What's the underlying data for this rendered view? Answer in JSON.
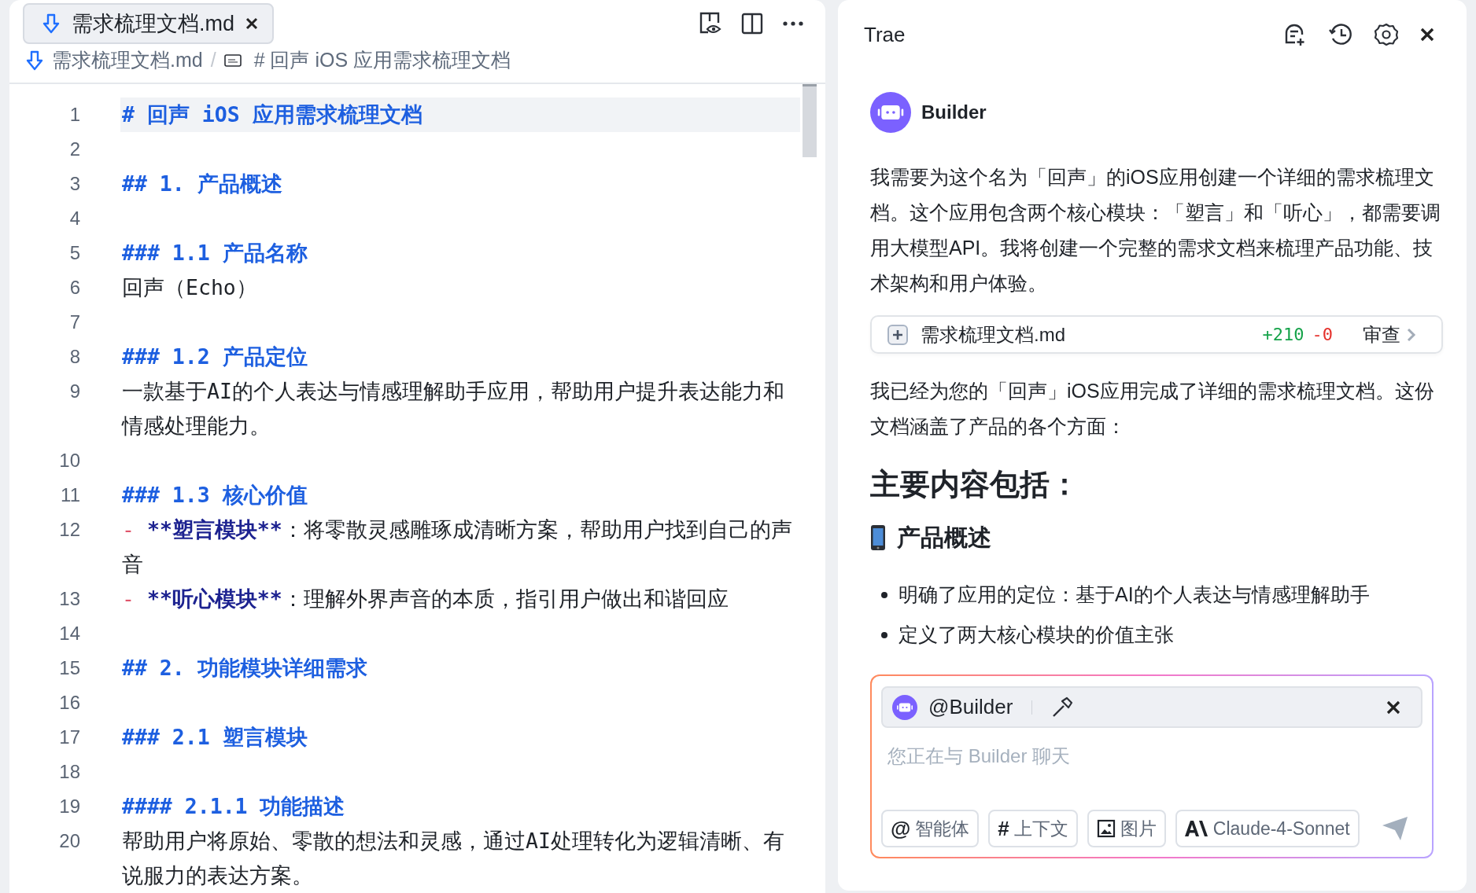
{
  "editor": {
    "tab": {
      "label": "需求梳理文档.md",
      "selected": true
    },
    "breadcrumb": {
      "file": "需求梳理文档.md",
      "separator": "/",
      "symbol": "# 回声 iOS 应用需求梳理文档"
    },
    "lines": [
      {
        "number": "1",
        "kind": "heading",
        "current": true,
        "text": "# 回声 iOS 应用需求梳理文档"
      },
      {
        "number": "2",
        "kind": "blank",
        "current": false
      },
      {
        "number": "3",
        "kind": "heading",
        "current": false,
        "text": "## 1. 产品概述"
      },
      {
        "number": "4",
        "kind": "blank",
        "current": false
      },
      {
        "number": "5",
        "kind": "heading",
        "current": false,
        "text": "### 1.1 产品名称"
      },
      {
        "number": "6",
        "kind": "text",
        "current": false,
        "text": "回声（Echo）"
      },
      {
        "number": "7",
        "kind": "blank",
        "current": false
      },
      {
        "number": "8",
        "kind": "heading",
        "current": false,
        "text": "### 1.2 产品定位"
      },
      {
        "number": "9",
        "kind": "text",
        "current": false,
        "text": "一款基于AI的个人表达与情感理解助手应用，帮助用户提升表达能力和情感处理能力。"
      },
      {
        "number": "10",
        "kind": "blank",
        "current": false
      },
      {
        "number": "11",
        "kind": "heading",
        "current": false,
        "text": "### 1.3 核心价值"
      },
      {
        "number": "12",
        "kind": "bullet",
        "current": false,
        "marker": "-",
        "emphasis": "**塑言模块**",
        "text": "：将零散灵感雕琢成清晰方案，帮助用户找到自己的声音"
      },
      {
        "number": "13",
        "kind": "bullet",
        "current": false,
        "marker": "-",
        "emphasis": "**听心模块**",
        "text": "：理解外界声音的本质，指引用户做出和谐回应"
      },
      {
        "number": "14",
        "kind": "blank",
        "current": false
      },
      {
        "number": "15",
        "kind": "heading",
        "current": false,
        "text": "## 2. 功能模块详细需求"
      },
      {
        "number": "16",
        "kind": "blank",
        "current": false
      },
      {
        "number": "17",
        "kind": "heading",
        "current": false,
        "text": "### 2.1 塑言模块"
      },
      {
        "number": "18",
        "kind": "blank",
        "current": false
      },
      {
        "number": "19",
        "kind": "heading",
        "current": false,
        "text": "#### 2.1.1 功能描述"
      },
      {
        "number": "20",
        "kind": "text",
        "current": false,
        "text": "帮助用户将原始、零散的想法和灵感，通过AI处理转化为逻辑清晰、有说服力的表达方案。"
      }
    ]
  },
  "chat": {
    "title": "Trae",
    "agent": "Builder",
    "messages": [
      {
        "kind": "paragraph",
        "text": "我需要为这个名为「回声」的iOS应用创建一个详细的需求梳理文档。这个应用包含两个核心模块：「塑言」和「听心」，都需要调用大模型API。我将创建一个完整的需求文档来梳理产品功能、技术架构和用户体验。"
      },
      {
        "kind": "file_change",
        "file": "需求梳理文档.md",
        "added": "+210",
        "removed": "-0",
        "action": "审查"
      },
      {
        "kind": "paragraph",
        "text": "我已经为您的「回声」iOS应用完成了详细的需求梳理文档。这份文档涵盖了产品的各个方面："
      },
      {
        "kind": "heading",
        "text": "主要内容包括："
      },
      {
        "kind": "subheading",
        "text": "产品概述"
      },
      {
        "kind": "bullet",
        "text": "明确了应用的定位：基于AI的个人表达与情感理解助手"
      },
      {
        "kind": "bullet",
        "text": "定义了两大核心模块的价值主张"
      }
    ],
    "input": {
      "mention": "@Builder",
      "placeholder": "您正在与 Builder 聊天",
      "buttons": [
        {
          "kind": "glyph",
          "icon": "@",
          "label": "智能体"
        },
        {
          "kind": "glyph",
          "icon": "#",
          "label": "上下文"
        },
        {
          "kind": "image",
          "label": "图片"
        },
        {
          "kind": "model",
          "label": "Claude-4-Sonnet"
        }
      ]
    }
  }
}
